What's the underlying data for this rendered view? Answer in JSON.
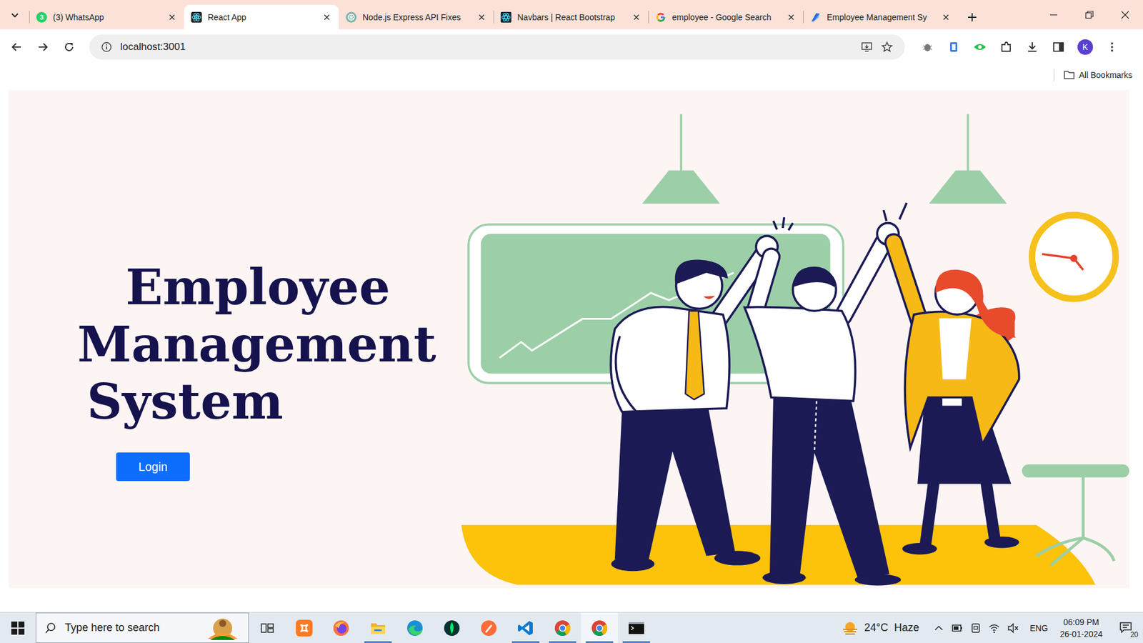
{
  "window": {
    "title": "React App"
  },
  "tabs": [
    {
      "label": "(3) WhatsApp",
      "selected": false,
      "kind": "whatsapp",
      "badge": "3"
    },
    {
      "label": "React App",
      "selected": true,
      "kind": "react"
    },
    {
      "label": "Node.js Express API Fixes",
      "selected": false,
      "kind": "chatgpt"
    },
    {
      "label": "Navbars | React Bootstrap",
      "selected": false,
      "kind": "bootstrap"
    },
    {
      "label": "employee - Google Search",
      "selected": false,
      "kind": "google"
    },
    {
      "label": "Employee Management Sy",
      "selected": false,
      "kind": "app"
    }
  ],
  "address_bar": {
    "url": "localhost:3001"
  },
  "profile": {
    "initial": "K"
  },
  "bookmarks_bar": {
    "all_bookmarks": "All Bookmarks"
  },
  "page": {
    "title_lines": [
      "Employee",
      "Management",
      "System"
    ],
    "login_button": "Login"
  },
  "taskbar": {
    "search_placeholder": "Type here to search",
    "apps": [
      {
        "kind": "xampp",
        "running": false,
        "selected": false
      },
      {
        "kind": "firefox",
        "running": false,
        "selected": false
      },
      {
        "kind": "explorer",
        "running": true,
        "selected": false
      },
      {
        "kind": "edge",
        "running": false,
        "selected": false
      },
      {
        "kind": "mongodb",
        "running": false,
        "selected": false
      },
      {
        "kind": "postman",
        "running": false,
        "selected": false
      },
      {
        "kind": "vscode",
        "running": true,
        "selected": false
      },
      {
        "kind": "chrome",
        "running": true,
        "selected": false
      },
      {
        "kind": "chrome",
        "running": true,
        "selected": true
      },
      {
        "kind": "terminal",
        "running": true,
        "selected": false
      }
    ],
    "weather": {
      "temp": "24°C",
      "condition": "Haze"
    },
    "language": "ENG",
    "time": "06:09 PM",
    "date": "26-01-2024",
    "notifications": "20"
  }
}
